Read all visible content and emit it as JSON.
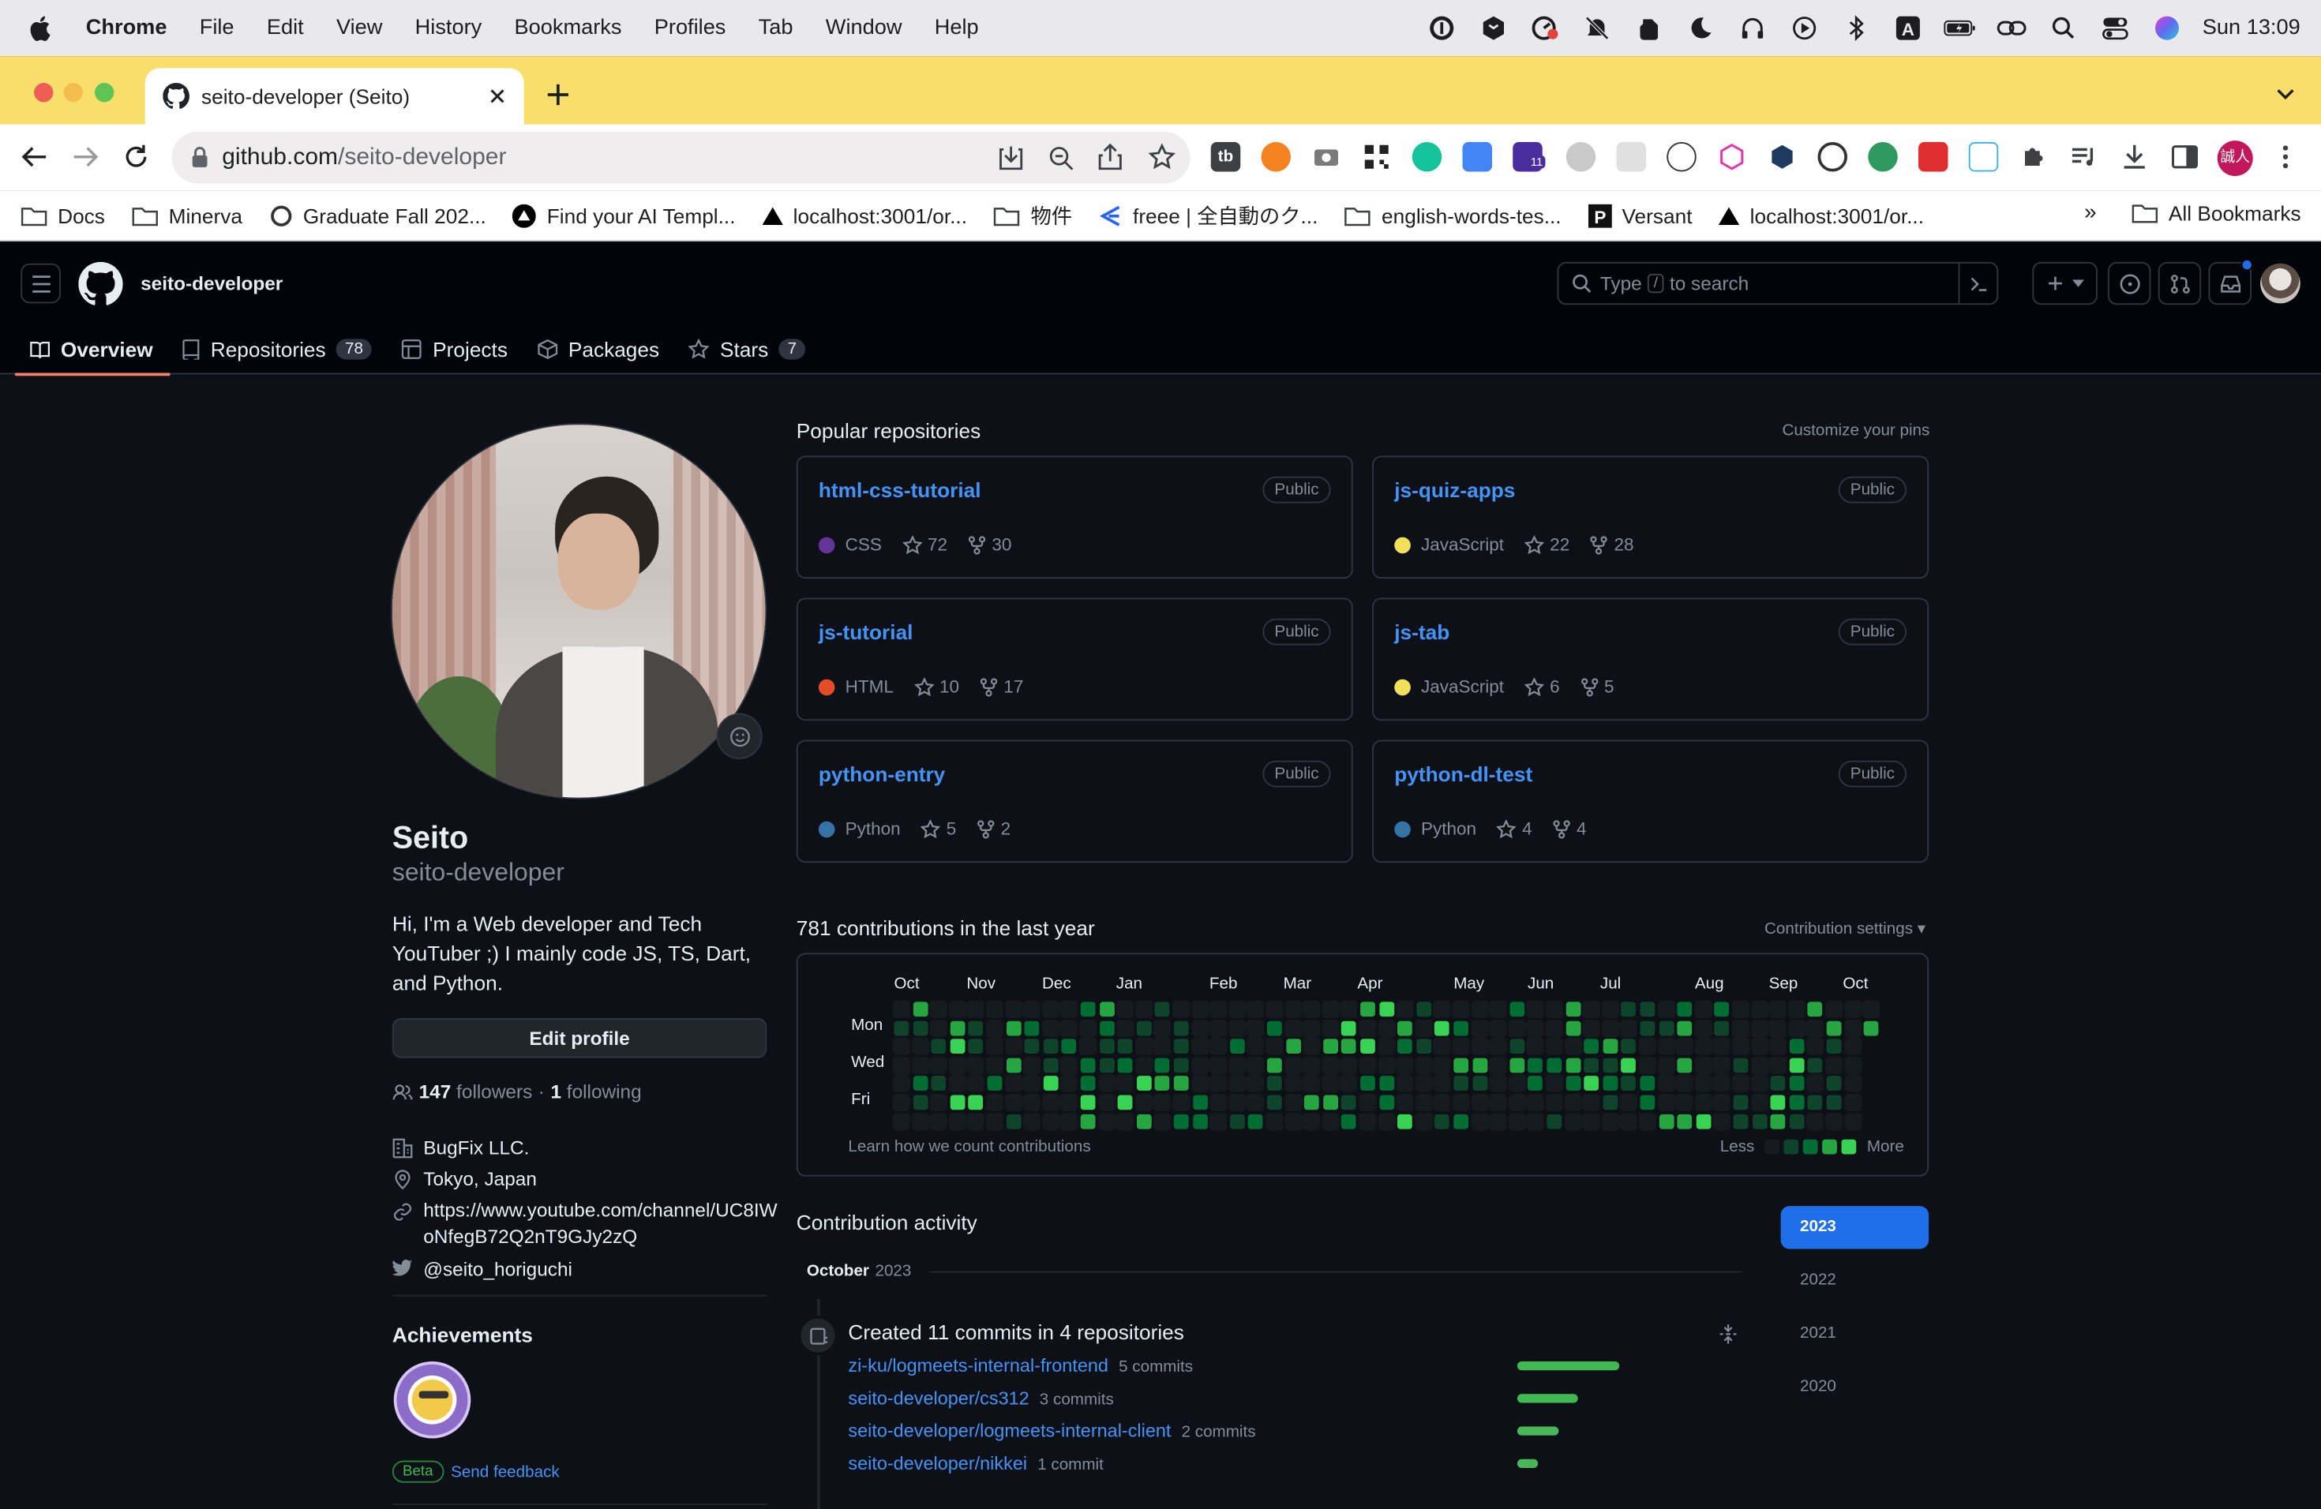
{
  "menubar": {
    "app": "Chrome",
    "items": [
      "File",
      "Edit",
      "View",
      "History",
      "Bookmarks",
      "Profiles",
      "Tab",
      "Window",
      "Help"
    ],
    "clock": "Sun 13:09"
  },
  "browser": {
    "tab_title": "seito-developer (Seito)",
    "url_host": "github.com",
    "url_path": "/seito-developer",
    "extension_badge": "11",
    "profile_label": "誠人",
    "bookmarks": [
      "Docs",
      "Minerva",
      "Graduate Fall 202...",
      "Find your AI Templ...",
      "localhost:3001/or...",
      "物件",
      "freee | 全自動のク...",
      "english-words-tes...",
      "Versant",
      "localhost:3001/or..."
    ],
    "bookmarks_more": "»",
    "all_bookmarks": "All Bookmarks"
  },
  "github": {
    "username": "seito-developer",
    "search_placeholder_pre": "Type",
    "search_key": "/",
    "search_placeholder_post": "to search",
    "tabs": [
      {
        "label": "Overview"
      },
      {
        "label": "Repositories",
        "count": "78"
      },
      {
        "label": "Projects"
      },
      {
        "label": "Packages"
      },
      {
        "label": "Stars",
        "count": "7"
      }
    ]
  },
  "profile": {
    "name": "Seito",
    "login": "seito-developer",
    "bio": "Hi, I'm a Web developer and Tech YouTuber ;) I mainly code JS, TS, Dart, and Python.",
    "edit_button": "Edit profile",
    "followers_count": "147",
    "followers_label": "followers",
    "sep": "·",
    "following_count": "1",
    "following_label": "following",
    "company": "BugFix LLC.",
    "location": "Tokyo, Japan",
    "website_line1": "https://www.youtube.com/channel/UC8IW",
    "website_line2": "oNfegB72Q2nT9GJy2zQ",
    "twitter": "@seito_horiguchi",
    "achievements_title": "Achievements",
    "beta": "Beta",
    "feedback": "Send feedback"
  },
  "popular": {
    "title": "Popular repositories",
    "customize": "Customize your pins",
    "repos": [
      {
        "name": "html-css-tutorial",
        "visibility": "Public",
        "language": "CSS",
        "lang_color": "#663399",
        "stars": "72",
        "forks": "30"
      },
      {
        "name": "js-quiz-apps",
        "visibility": "Public",
        "language": "JavaScript",
        "lang_color": "#f1e05a",
        "stars": "22",
        "forks": "28"
      },
      {
        "name": "js-tutorial",
        "visibility": "Public",
        "language": "HTML",
        "lang_color": "#e34c26",
        "stars": "10",
        "forks": "17"
      },
      {
        "name": "js-tab",
        "visibility": "Public",
        "language": "JavaScript",
        "lang_color": "#f1e05a",
        "stars": "6",
        "forks": "5"
      },
      {
        "name": "python-entry",
        "visibility": "Public",
        "language": "Python",
        "lang_color": "#3572A5",
        "stars": "5",
        "forks": "2"
      },
      {
        "name": "python-dl-test",
        "visibility": "Public",
        "language": "Python",
        "lang_color": "#3572A5",
        "stars": "4",
        "forks": "4"
      }
    ]
  },
  "contributions": {
    "title": "781 contributions in the last year",
    "settings": "Contribution settings ▾",
    "months": [
      "Oct",
      "Nov",
      "Dec",
      "Jan",
      "Feb",
      "Mar",
      "Apr",
      "May",
      "Jun",
      "Jul",
      "Aug",
      "Sep",
      "Oct"
    ],
    "days": [
      "Mon",
      "Wed",
      "Fri"
    ],
    "learn": "Learn how we count contributions",
    "less": "Less",
    "more": "More",
    "colors": [
      "#161b22",
      "#0e4429",
      "#006d32",
      "#26a641",
      "#39d353"
    ]
  },
  "activity": {
    "title": "Contribution activity",
    "month": "October",
    "year": "2023",
    "summary": "Created 11 commits in 4 repositories",
    "repos": [
      {
        "name": "zi-ku/logmeets-internal-frontend",
        "commits": "5 commits",
        "share": 1.0
      },
      {
        "name": "seito-developer/cs312",
        "commits": "3 commits",
        "share": 0.6
      },
      {
        "name": "seito-developer/logmeets-internal-client",
        "commits": "2 commits",
        "share": 0.4
      },
      {
        "name": "seito-developer/nikkei",
        "commits": "1 commit",
        "share": 0.2
      }
    ],
    "years": [
      "2023",
      "2022",
      "2021",
      "2020"
    ]
  }
}
